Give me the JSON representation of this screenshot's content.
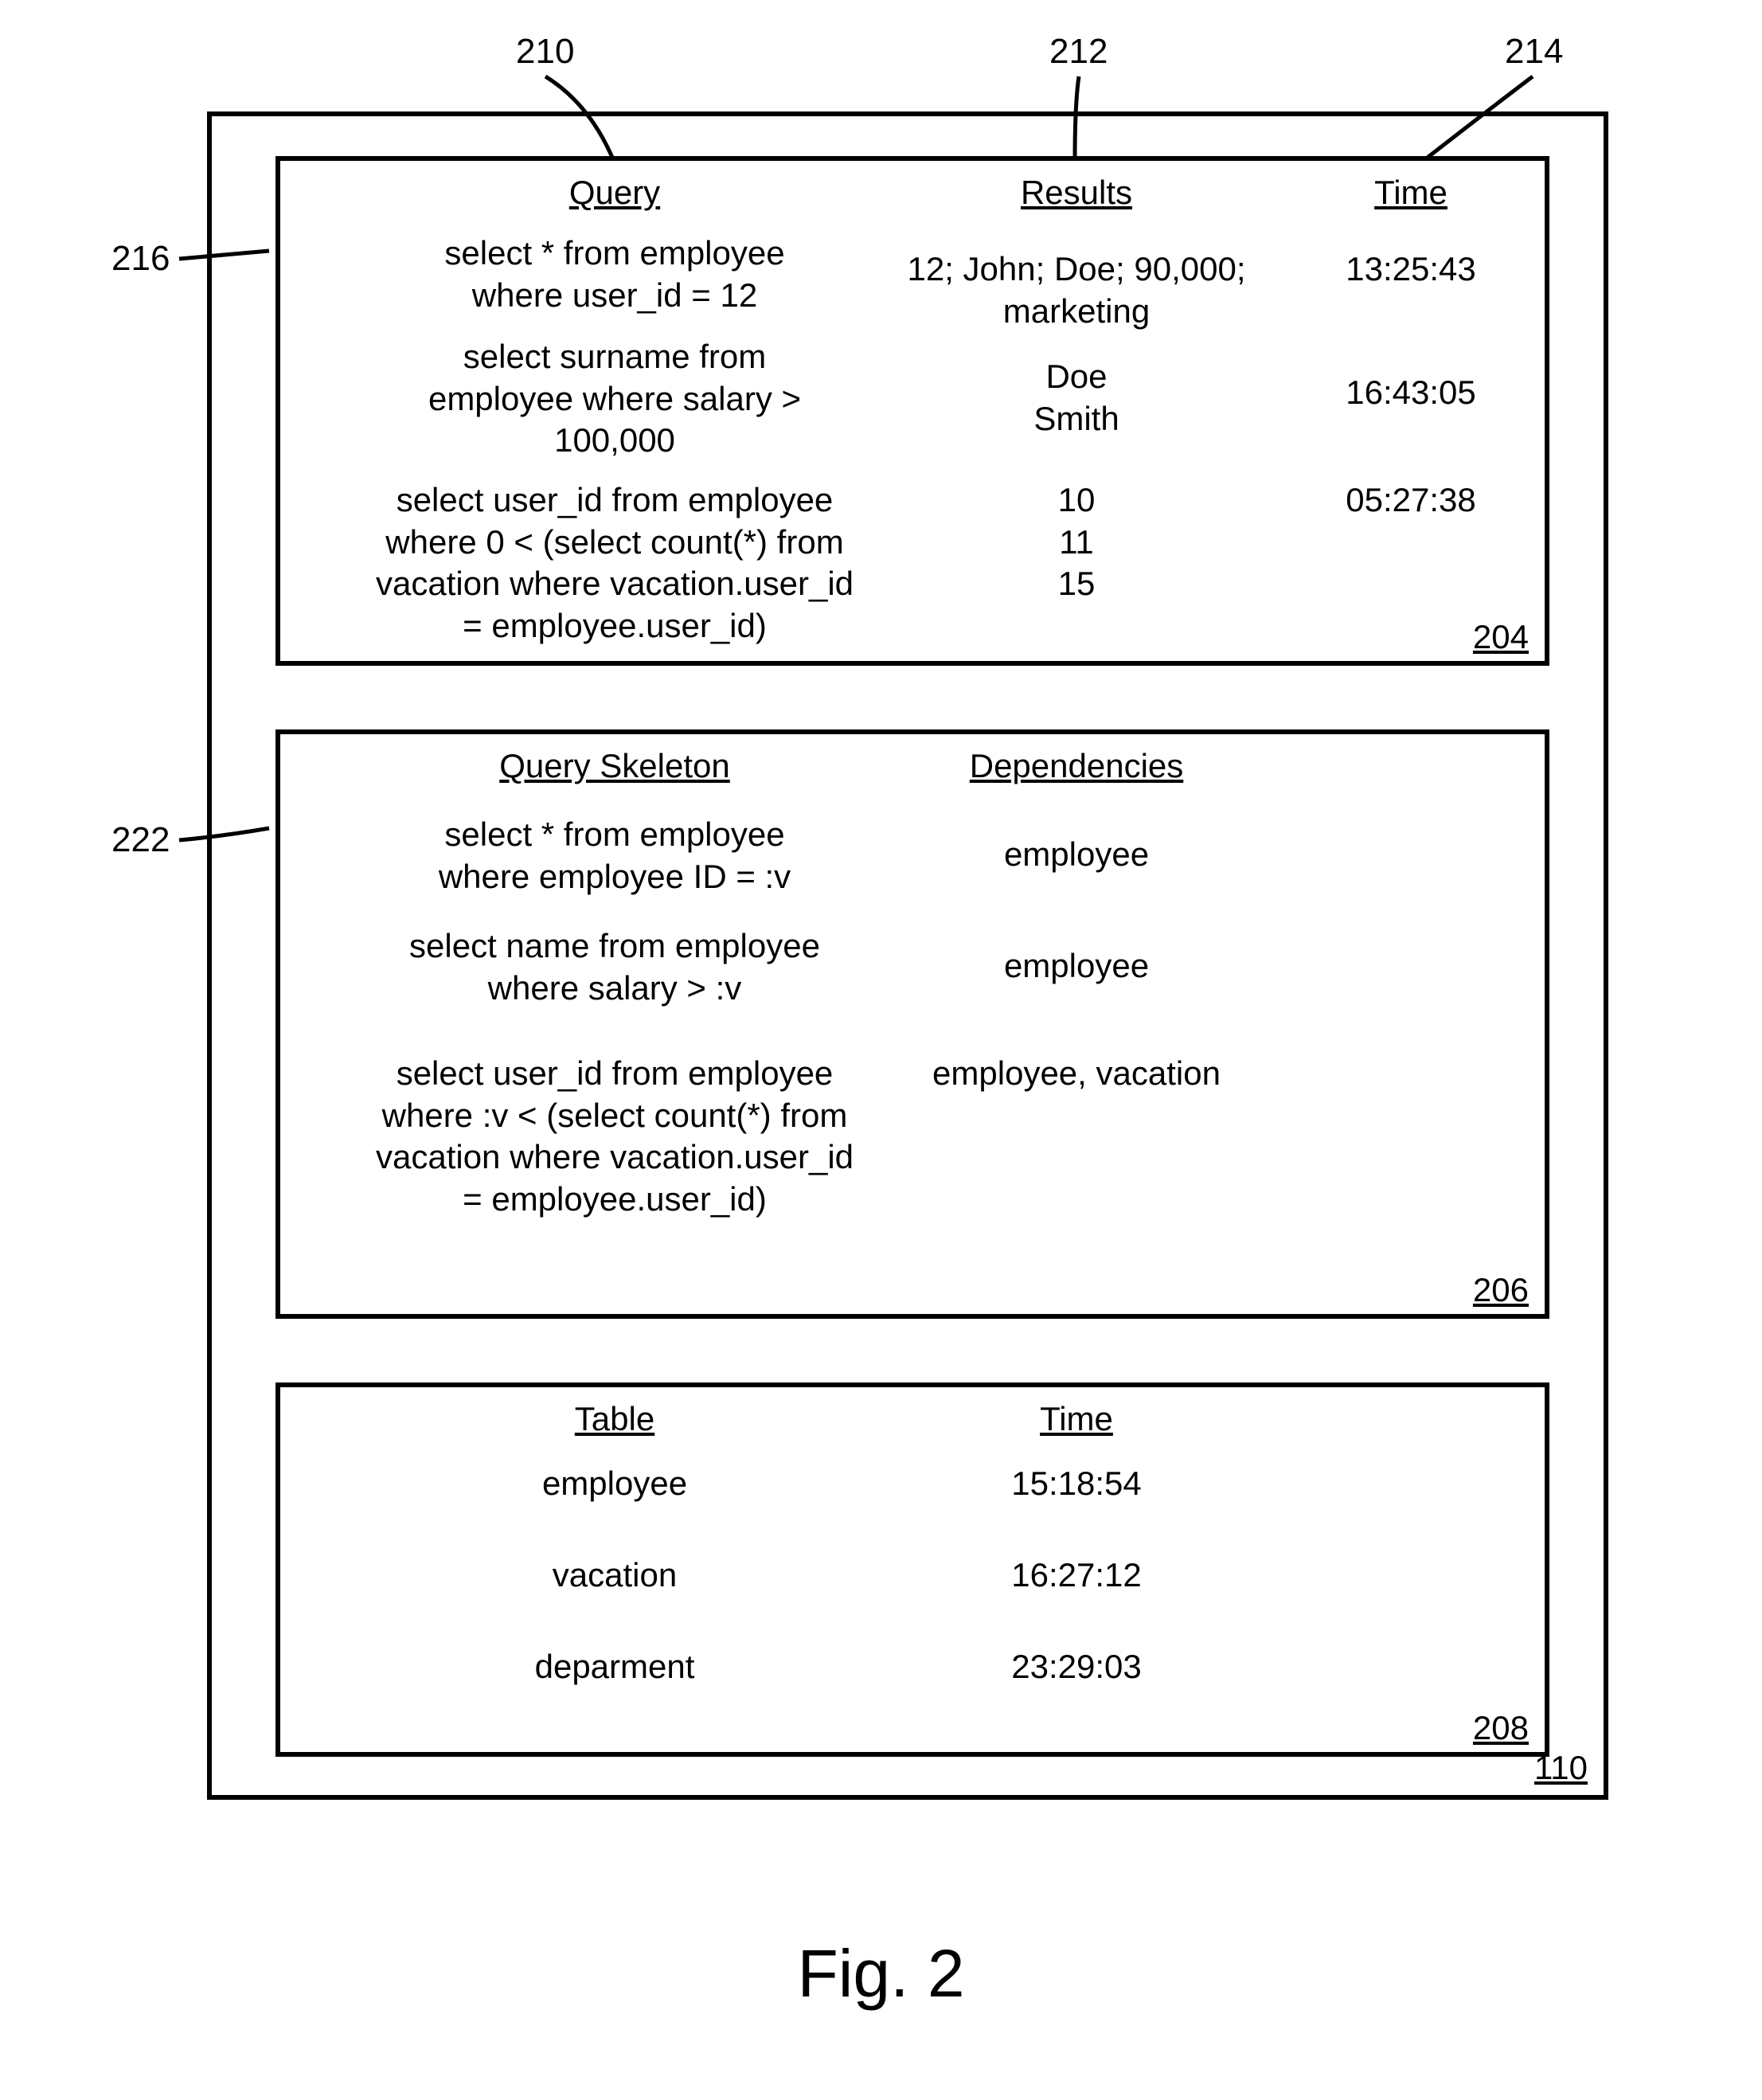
{
  "figure_caption": "Fig. 2",
  "outer_ref": "110",
  "top_labels": {
    "l210": "210",
    "l212": "212",
    "l214": "214"
  },
  "side_labels": {
    "l216": "216",
    "l222": "222"
  },
  "box204": {
    "ref": "204",
    "headers": {
      "query": "Query",
      "results": "Results",
      "time": "Time"
    },
    "rows": [
      {
        "query": "select * from employee\nwhere user_id = 12",
        "results": "12; John; Doe; 90,000; marketing",
        "time": "13:25:43"
      },
      {
        "query": "select surname from\nemployee where salary >\n100,000",
        "results": "Doe\nSmith",
        "time": "16:43:05"
      },
      {
        "query": "select user_id from employee\nwhere 0 < (select count(*) from\nvacation where vacation.user_id\n= employee.user_id)",
        "results": "10\n11\n15",
        "time": "05:27:38"
      }
    ]
  },
  "box206": {
    "ref": "206",
    "headers": {
      "skeleton": "Query Skeleton",
      "deps": "Dependencies"
    },
    "rows": [
      {
        "skeleton": "select * from employee\nwhere employee ID = :v",
        "deps": "employee"
      },
      {
        "skeleton": "select name from employee\nwhere salary > :v",
        "deps": "employee"
      },
      {
        "skeleton": "select user_id from employee\nwhere :v < (select count(*) from\nvacation where vacation.user_id\n= employee.user_id)",
        "deps": "employee, vacation"
      }
    ]
  },
  "box208": {
    "ref": "208",
    "headers": {
      "table": "Table",
      "time": "Time"
    },
    "rows": [
      {
        "table": "employee",
        "time": "15:18:54"
      },
      {
        "table": "vacation",
        "time": "16:27:12"
      },
      {
        "table": "deparment",
        "time": "23:29:03"
      }
    ]
  }
}
